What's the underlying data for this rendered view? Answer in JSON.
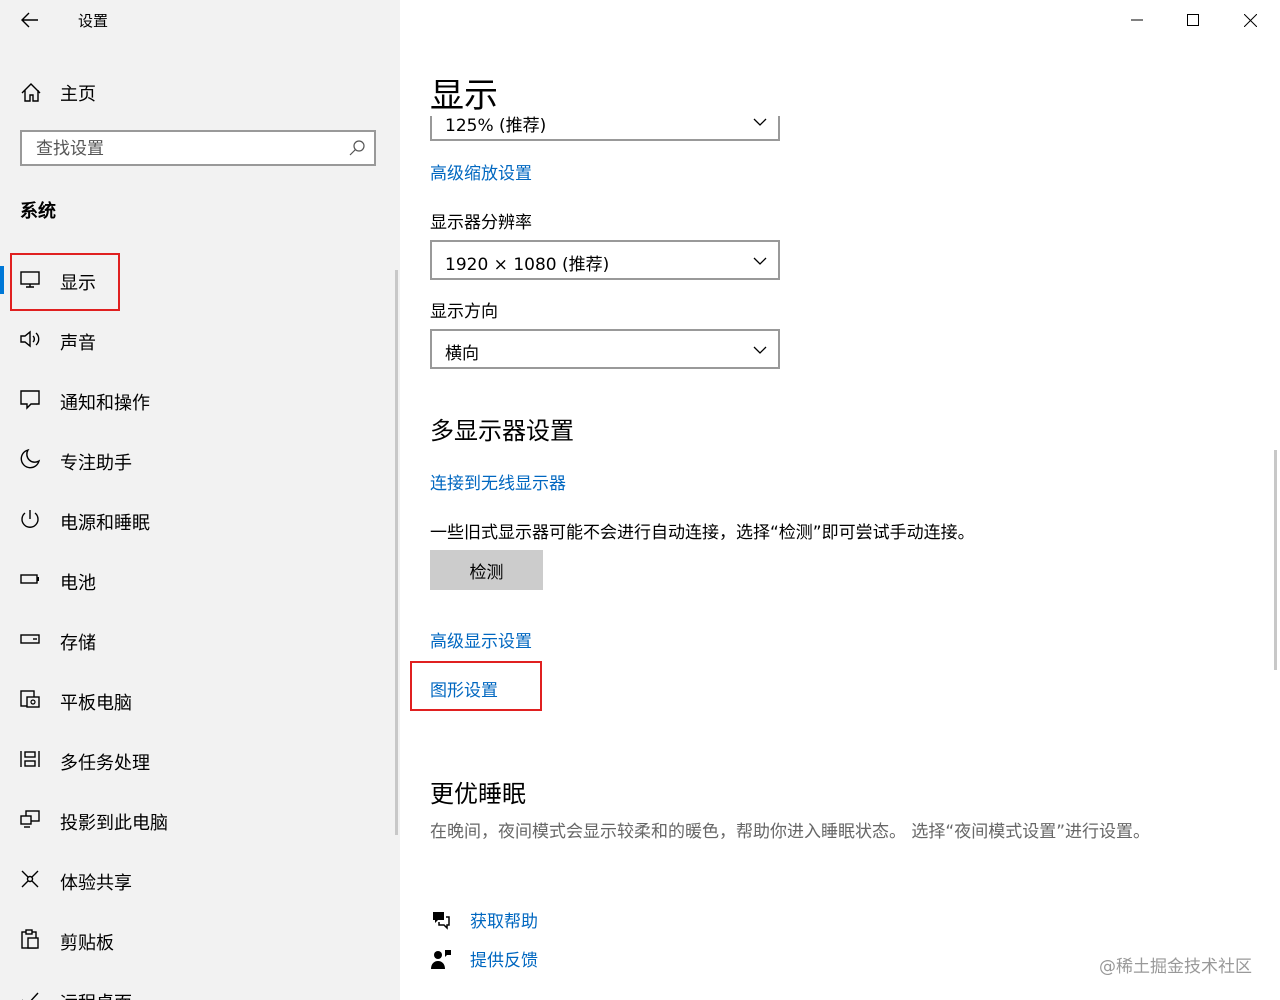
{
  "window": {
    "title": "设置",
    "controls": {
      "minimize": "minimize",
      "maximize": "maximize",
      "close": "close"
    }
  },
  "sidebar": {
    "home_label": "主页",
    "search_placeholder": "查找设置",
    "section_title": "系统",
    "items": [
      {
        "label": "显示",
        "icon": "monitor-icon",
        "active": true
      },
      {
        "label": "声音",
        "icon": "speaker-icon"
      },
      {
        "label": "通知和操作",
        "icon": "notification-icon"
      },
      {
        "label": "专注助手",
        "icon": "moon-icon"
      },
      {
        "label": "电源和睡眠",
        "icon": "power-icon"
      },
      {
        "label": "电池",
        "icon": "battery-icon"
      },
      {
        "label": "存储",
        "icon": "storage-icon"
      },
      {
        "label": "平板电脑",
        "icon": "tablet-icon"
      },
      {
        "label": "多任务处理",
        "icon": "multitask-icon"
      },
      {
        "label": "投影到此电脑",
        "icon": "project-icon"
      },
      {
        "label": "体验共享",
        "icon": "share-icon"
      },
      {
        "label": "剪贴板",
        "icon": "clipboard-icon"
      },
      {
        "label": "远程桌面",
        "icon": "remote-icon"
      }
    ]
  },
  "main": {
    "title": "显示",
    "scale_value": "125% (推荐)",
    "advanced_scaling_link": "高级缩放设置",
    "resolution_label": "显示器分辨率",
    "resolution_value": "1920 × 1080 (推荐)",
    "orientation_label": "显示方向",
    "orientation_value": "横向",
    "multi_display_title": "多显示器设置",
    "wireless_link": "连接到无线显示器",
    "detect_desc": "一些旧式显示器可能不会进行自动连接，选择“检测”即可尝试手动连接。",
    "detect_button": "检测",
    "advanced_display_link": "高级显示设置",
    "graphics_link": "图形设置",
    "sleep_title": "更优睡眠",
    "sleep_desc": "在晚间，夜间模式会显示较柔和的暖色，帮助你进入睡眠状态。 选择“夜间模式设置”进行设置。",
    "help_link": "获取帮助",
    "feedback_link": "提供反馈"
  },
  "watermark": "@稀土掘金技术社区",
  "colors": {
    "accent": "#0078d7",
    "link": "#0067c0",
    "highlight_box": "#e02020",
    "sidebar_bg": "#f2f2f2"
  }
}
